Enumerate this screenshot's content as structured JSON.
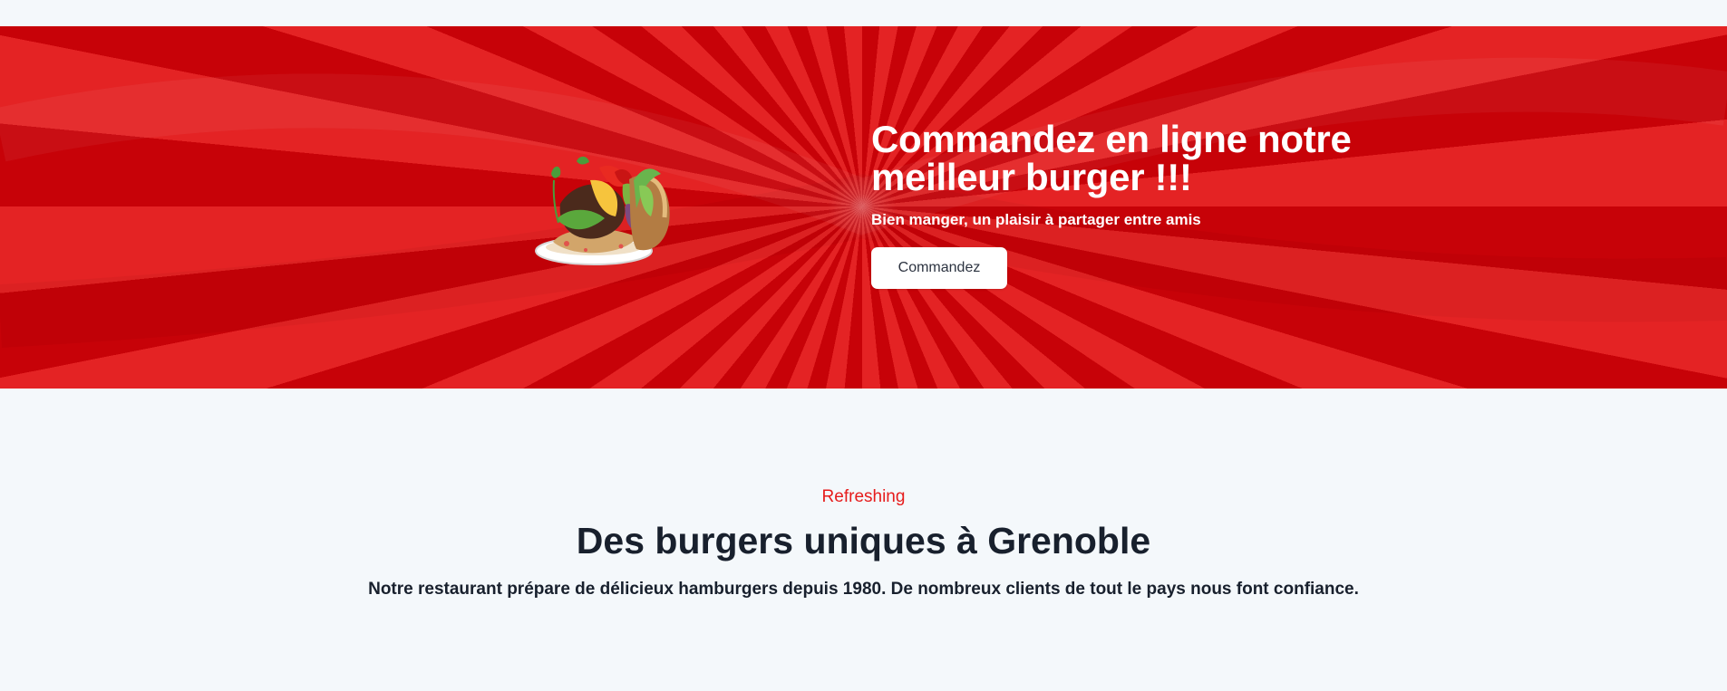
{
  "hero": {
    "title": "Commandez en ligne notre meilleur burger !!!",
    "subtitle": "Bien manger, un plaisir à partager entre amis",
    "button_label": "Commandez",
    "background_colors": [
      "#c70208",
      "#e42324"
    ],
    "image": "burger-illustration"
  },
  "intro": {
    "kicker": "Refreshing",
    "title": "Des burgers uniques à Grenoble",
    "description": "Notre restaurant prépare de délicieux hamburgers depuis 1980. De nombreux clients de tout le pays nous font confiance."
  },
  "colors": {
    "accent": "#e61c1c",
    "text": "#18202d",
    "page_background": "#f4f8fb"
  }
}
